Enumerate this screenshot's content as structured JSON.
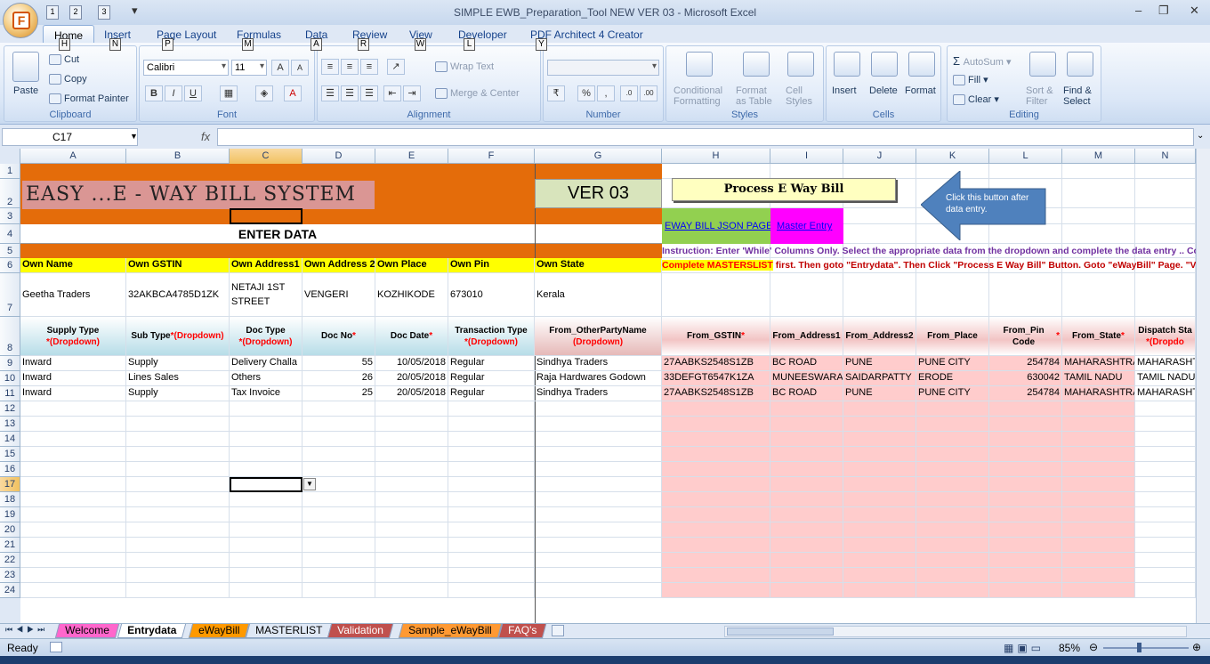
{
  "window": {
    "title": "SIMPLE EWB_Preparation_Tool NEW VER 03 - Microsoft Excel",
    "office_button_letter": "F",
    "qat_keytips": [
      "1",
      "2",
      "3"
    ]
  },
  "ribbon_tabs": [
    {
      "label": "Home",
      "key": "H"
    },
    {
      "label": "Insert",
      "key": "N"
    },
    {
      "label": "Page Layout",
      "key": "P"
    },
    {
      "label": "Formulas",
      "key": "M"
    },
    {
      "label": "Data",
      "key": "A"
    },
    {
      "label": "Review",
      "key": "R"
    },
    {
      "label": "View",
      "key": "W"
    },
    {
      "label": "Developer",
      "key": "L"
    },
    {
      "label": "PDF Architect 4 Creator",
      "key": "Y"
    }
  ],
  "ribbon": {
    "clipboard": {
      "label": "Clipboard",
      "paste": "Paste",
      "cut": "Cut",
      "copy": "Copy",
      "format_painter": "Format Painter"
    },
    "font": {
      "label": "Font",
      "name": "Calibri",
      "size": "11",
      "grow": "A",
      "shrink": "A",
      "bold": "B",
      "italic": "I",
      "underline": "U",
      "color": "A"
    },
    "alignment": {
      "label": "Alignment",
      "wrap": "Wrap Text",
      "merge": "Merge & Center"
    },
    "number": {
      "label": "Number",
      "percent": "%",
      "comma": ","
    },
    "styles": {
      "label": "Styles",
      "conditional": "Conditional",
      "conditional2": "Formatting",
      "format_table": "Format",
      "format_table2": "as Table",
      "cell_styles": "Cell",
      "cell_styles2": "Styles"
    },
    "cells": {
      "label": "Cells",
      "insert": "Insert",
      "delete": "Delete",
      "format": "Format"
    },
    "editing": {
      "label": "Editing",
      "autosum": "AutoSum",
      "fill": "Fill",
      "clear": "Clear",
      "sort": "Sort &",
      "sort2": "Filter",
      "find": "Find &",
      "find2": "Select"
    }
  },
  "formula_bar": {
    "name_box": "C17",
    "fx": "fx",
    "value": ""
  },
  "columns": [
    "A",
    "B",
    "C",
    "D",
    "E",
    "F",
    "G",
    "H",
    "I",
    "J",
    "K",
    "L",
    "M",
    "N"
  ],
  "rows": [
    "1",
    "2",
    "3",
    "4",
    "5",
    "6",
    "7",
    "8",
    "9",
    "10",
    "11",
    "12",
    "13",
    "14",
    "15",
    "16",
    "17",
    "18",
    "19",
    "20",
    "21",
    "22",
    "23",
    "24"
  ],
  "sheet": {
    "banner": "EASY ...E - WAY BILL  SYSTEM",
    "version": "VER 03",
    "process_button": "Process E Way Bill",
    "callout": "Click this  button after data  entry.",
    "json_link": "EWAY BILL JSON PAGE",
    "master_link": "Master Entry",
    "enter_data": "ENTER DATA",
    "instruction1": "Instruction: Enter 'While' Columns Only.  Select the appropriate data from the dropdown and complete the data entry .. Co",
    "instruction2a": "Complete MASTERSLIST",
    "instruction2b": " first. Then goto \"Entrydata\". Then Click \"Process E Way Bill\" Button. Goto \"eWayBill\" Page. \"Vali",
    "own_headers": [
      "Own Name",
      "Own GSTIN",
      "Own Address1",
      "Own Address 2",
      "Own Place",
      "Own Pin",
      "Own State"
    ],
    "own_values": [
      "Geetha Traders",
      "32AKBCA4785D1ZK",
      "NETAJI 1ST STREET",
      "VENGERI",
      "KOZHIKODE",
      "673010",
      "Kerala"
    ],
    "headers": [
      {
        "text": "Supply Type",
        "sub": "*(Dropdown)"
      },
      {
        "text": "Sub Type ",
        "sub": "*(Dropdown)"
      },
      {
        "text": "Doc Type",
        "sub": "*(Dropdown)"
      },
      {
        "text": "Doc No ",
        "sub": "*"
      },
      {
        "text": "Doc Date ",
        "sub": "*"
      },
      {
        "text": "Transaction Type",
        "sub": "*(Dropdown)"
      },
      {
        "text": "From_OtherPartyName",
        "sub": "(Dropdown)"
      },
      {
        "text": "From_GSTIN ",
        "sub": "*"
      },
      {
        "text": "From_Address1",
        "sub": ""
      },
      {
        "text": "From_Address2",
        "sub": ""
      },
      {
        "text": "From_Place",
        "sub": ""
      },
      {
        "text": "From_Pin Code ",
        "sub": "*"
      },
      {
        "text": "From_State ",
        "sub": "*"
      },
      {
        "text": "Dispatch Sta",
        "sub": "*(Dropdo"
      }
    ],
    "data_rows": [
      [
        "Inward",
        "Supply",
        "Delivery Challa",
        "55",
        "10/05/2018",
        "Regular",
        "Sindhya Traders",
        "27AABKS2548S1ZB",
        "BC ROAD",
        "PUNE",
        "PUNE CITY",
        "254784",
        "MAHARASHTRA",
        "MAHARASHT"
      ],
      [
        "Inward",
        "Lines Sales",
        "Others",
        "26",
        "20/05/2018",
        "Regular",
        "Raja Hardwares Godown",
        "33DEFGT6547K1ZA",
        "MUNEESWARAI",
        "SAIDARPATTY",
        "ERODE",
        "630042",
        "TAMIL NADU",
        "TAMIL NADU"
      ],
      [
        "Inward",
        "Supply",
        "Tax Invoice",
        "25",
        "20/05/2018",
        "Regular",
        "Sindhya Traders",
        "27AABKS2548S1ZB",
        "BC ROAD",
        "PUNE",
        "PUNE CITY",
        "254784",
        "MAHARASHTRA",
        "MAHARASHT"
      ]
    ]
  },
  "sheet_tabs": [
    {
      "label": "Welcome",
      "color": "#ff66cc"
    },
    {
      "label": "Entrydata",
      "color": "#ffffff"
    },
    {
      "label": "eWayBill",
      "color": "#ff9900"
    },
    {
      "label": "MASTERLIST",
      "color": "#dfe8f5"
    },
    {
      "label": "Validation",
      "color": "#c0504d"
    },
    {
      "label": "Sample_eWayBill",
      "color": "#ff9933"
    },
    {
      "label": "FAQ's",
      "color": "#c0504d"
    }
  ],
  "status": {
    "ready": "Ready",
    "zoom": "85%"
  }
}
